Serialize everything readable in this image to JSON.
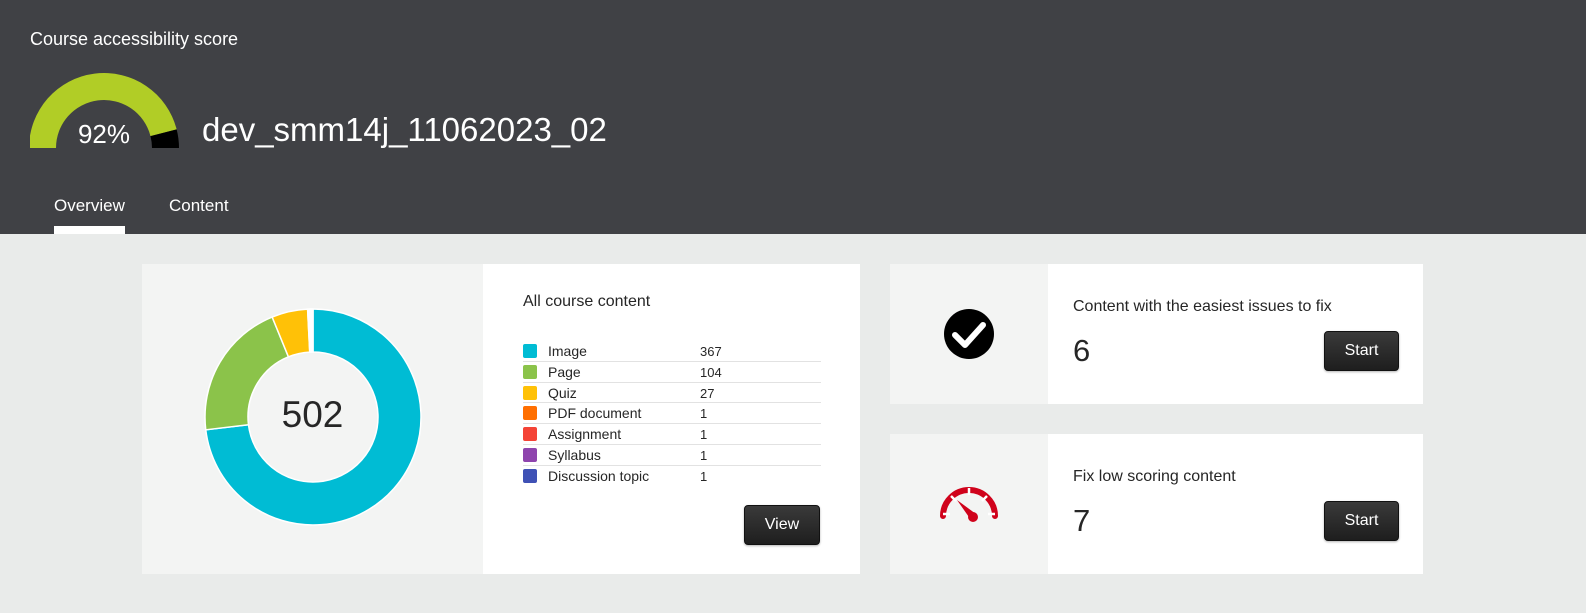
{
  "header": {
    "title": "Course accessibility score",
    "score_percent": 92,
    "score_label": "92%",
    "course_name": "dev_smm14j_11062023_02",
    "gauge_color": "#b1cd26"
  },
  "tabs": [
    {
      "label": "Overview",
      "active": true
    },
    {
      "label": "Content",
      "active": false
    }
  ],
  "content_summary": {
    "title": "All course content",
    "total": "502",
    "view_label": "View",
    "items": [
      {
        "label": "Image",
        "count": "367",
        "color": "#00bcd4"
      },
      {
        "label": "Page",
        "count": "104",
        "color": "#8bc34a"
      },
      {
        "label": "Quiz",
        "count": "27",
        "color": "#ffc107"
      },
      {
        "label": "PDF document",
        "count": "1",
        "color": "#ff6f00"
      },
      {
        "label": "Assignment",
        "count": "1",
        "color": "#f44336"
      },
      {
        "label": "Syllabus",
        "count": "1",
        "color": "#8e44ad"
      },
      {
        "label": "Discussion topic",
        "count": "1",
        "color": "#3f51b5"
      }
    ]
  },
  "actions": [
    {
      "title": "Content with the easiest issues to fix",
      "count": "6",
      "button_label": "Start",
      "icon": "checkmark-circle-icon"
    },
    {
      "title": "Fix low scoring content",
      "count": "7",
      "button_label": "Start",
      "icon": "speedometer-icon"
    }
  ]
}
